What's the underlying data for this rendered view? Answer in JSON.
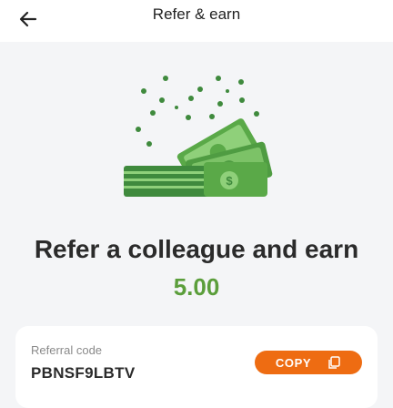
{
  "header": {
    "title": "Refer & earn",
    "back_icon": "arrow-left-icon"
  },
  "hero": {
    "illustration": "money-stack-icon",
    "colors": {
      "dark_green": "#3f8a3d",
      "mid_green": "#5aa948",
      "light_green": "#8fd07a"
    }
  },
  "main": {
    "headline": "Refer a colleague and earn",
    "amount": "5.00",
    "amount_color": "#5b9e3b"
  },
  "referral": {
    "label": "Referral code",
    "code": "PBNSF9LBTV",
    "copy_label": "COPY",
    "copy_icon": "copy-icon",
    "copy_color": "#ee6c12"
  }
}
